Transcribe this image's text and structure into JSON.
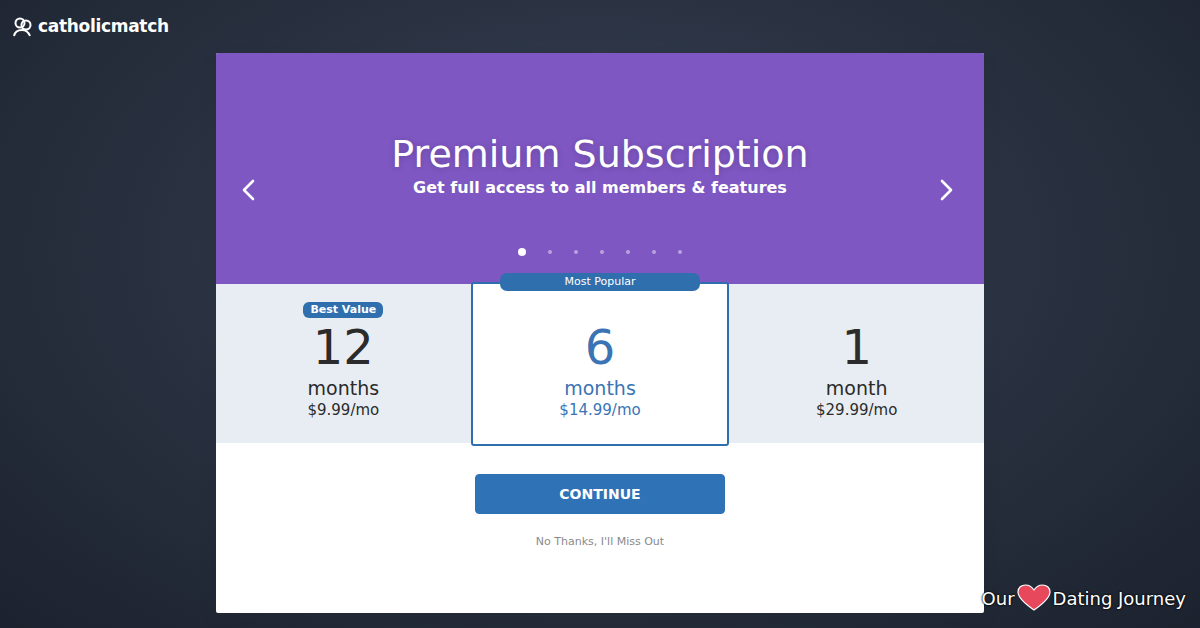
{
  "logo": {
    "text": "catholicmatch"
  },
  "header": {
    "title": "Premium Subscription",
    "subtitle": "Get full access to all members & features"
  },
  "carousel_dots": [
    {
      "selected": true
    },
    {
      "selected": false
    },
    {
      "selected": false
    },
    {
      "selected": false
    },
    {
      "selected": false
    },
    {
      "selected": false
    },
    {
      "selected": false
    }
  ],
  "plans": [
    {
      "badge": "Best Value",
      "months": "12",
      "unit": "months",
      "price": "$9.99/mo",
      "selected": false
    },
    {
      "badge": "Most Popular",
      "months": "6",
      "unit": "months",
      "price": "$14.99/mo",
      "selected": true
    },
    {
      "months": "1",
      "unit": "month",
      "price": "$29.99/mo",
      "selected": false
    }
  ],
  "continue_button": "CONTINUE",
  "decline_link": "No Thanks, I'll Miss Out",
  "watermark": {
    "before": "Our",
    "after": "Dating Journey"
  }
}
